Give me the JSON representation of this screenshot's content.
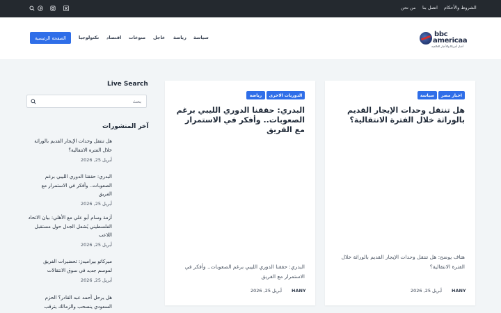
{
  "topbar": {
    "links": [
      "الشروط والأحكام",
      "اتصل بنا",
      "من نحن"
    ],
    "icons": [
      "x-icon",
      "instagram-icon",
      "pinterest-icon",
      "search-icon"
    ]
  },
  "brand": {
    "line1": "bbc",
    "line2": "americaa",
    "tagline": "أخبار أمريكا والأخبار العالمية"
  },
  "nav": {
    "items": [
      "سياسة",
      "رياضة",
      "عاجل",
      "منوعات",
      "اقتصاد",
      "تكنولوجيا"
    ],
    "home_button": "الصفحة الرئيسية"
  },
  "posts": [
    {
      "categories": [
        "سياسة",
        "اخبار مصر"
      ],
      "title": "هل تنتقل وحدات الإيجار القديم بالوراثة خلال الفترة الانتقالية؟",
      "excerpt": "هتاف يوضح: هل تنتقل وحدات الإيجار القديم بالوراثة خلال الفترة الانتقالية؟",
      "author": "HANY",
      "date": "أبريل 25, 2026"
    },
    {
      "categories": [
        "رياضة",
        "الدوريات الاخرى"
      ],
      "title": "البدري: حققنا الدوري الليبي برغم الصعوبات.. وأفكر في الاستمرار مع الفريق",
      "excerpt": "البدري: حققنا الدوري الليبي برغم الصعوبات.. وأفكر في الاستمرار مع الفريق",
      "author": "HANY",
      "date": "أبريل 25, 2026"
    }
  ],
  "sidebar": {
    "live_search_heading": "Live Search",
    "search_placeholder": "بحث",
    "recent_heading": "آخر المنشورات",
    "recent": [
      {
        "title": "هل تنتقل وحدات الإيجار القديم بالوراثة خلال الفترة الانتقالية؟",
        "date": "أبريل 25, 2026"
      },
      {
        "title": "البدري: حققنا الدوري الليبي برغم الصعوبات.. وأفكر في الاستمرار مع الفريق",
        "date": "أبريل 25, 2026"
      },
      {
        "title": "أزمة وسام أبو علي مع الأهلي: بيان الاتحاد الفلسطيني يُشعل الجدل حول مستقبل اللاعب",
        "date": "أبريل 25, 2026"
      },
      {
        "title": "ميركاتو بيراميدز: تحضيرات الفريق لموسم جديد في سوق الانتقالات",
        "date": "أبريل 25, 2026"
      },
      {
        "title": "هل يرحل أحمد عبد القادر؟ الحزم السعودي ينسحب والزمالك يترقب",
        "date": ""
      }
    ]
  },
  "colors": {
    "accent": "#2f6ee8",
    "topbar_bg": "#24292f",
    "page_bg": "#f2f5f7"
  }
}
